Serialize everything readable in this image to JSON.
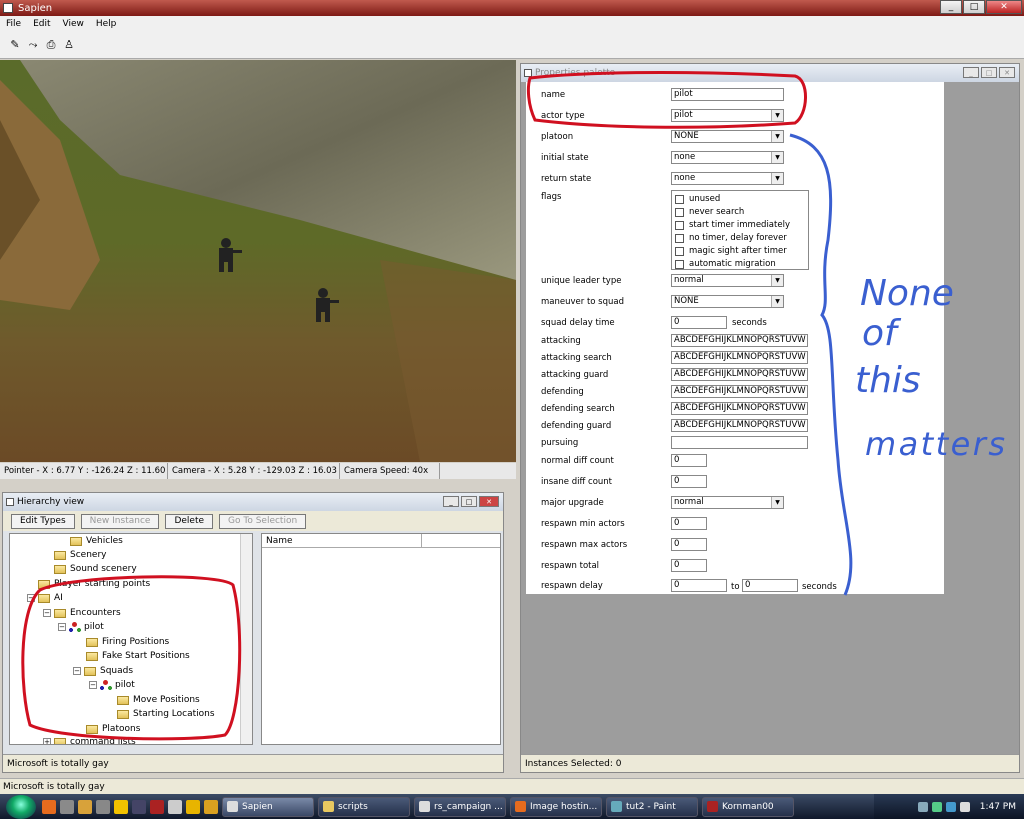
{
  "window": {
    "title": "Sapien",
    "min": "_",
    "max": "□",
    "close": "✕"
  },
  "menu": [
    "File",
    "Edit",
    "View",
    "Help"
  ],
  "toolbar": {
    "tools": [
      "pencil-tool",
      "path-tool",
      "camera-tool",
      "actor-tool"
    ]
  },
  "viewport": {
    "pointer": "Pointer - X : 6.77  Y : -126.24  Z : 11.60",
    "camera": "Camera - X : 5.28  Y : -129.03  Z : 16.03",
    "speed": "Camera Speed: 40x"
  },
  "hierarchy": {
    "title": "Hierarchy view",
    "buttons": {
      "edit_types": "Edit Types",
      "new_instance": "New Instance",
      "delete": "Delete",
      "go_to_selection": "Go To Selection"
    },
    "tree": [
      {
        "label": "Vehicles",
        "kind": "folder"
      },
      {
        "label": "Scenery",
        "kind": "folder"
      },
      {
        "label": "Sound scenery",
        "kind": "folder"
      },
      {
        "label": "Player starting points",
        "kind": "folder"
      },
      {
        "label": "AI",
        "kind": "folder"
      },
      {
        "label": "Encounters",
        "kind": "folder"
      },
      {
        "label": "pilot",
        "kind": "encounter"
      },
      {
        "label": "Firing Positions",
        "kind": "folder"
      },
      {
        "label": "Fake Start Positions",
        "kind": "folder"
      },
      {
        "label": "Squads",
        "kind": "folder"
      },
      {
        "label": "pilot",
        "kind": "encounter"
      },
      {
        "label": "Move Positions",
        "kind": "folder"
      },
      {
        "label": "Starting Locations",
        "kind": "folder"
      },
      {
        "label": "Platoons",
        "kind": "folder"
      },
      {
        "label": "command lists",
        "kind": "folder"
      }
    ],
    "list_header": "Name",
    "status": "Microsoft is totally gay"
  },
  "properties": {
    "title": "Properties palette",
    "name_label": "name",
    "name_value": "pilot",
    "actor_type_label": "actor type",
    "actor_type_value": "pilot",
    "platoon_label": "platoon",
    "platoon_value": "NONE",
    "initial_state_label": "initial state",
    "initial_state_value": "none",
    "return_state_label": "return state",
    "return_state_value": "none",
    "flags_label": "flags",
    "flags": [
      "unused",
      "never search",
      "start timer immediately",
      "no timer, delay forever",
      "magic sight after timer",
      "automatic migration"
    ],
    "unique_leader_label": "unique leader type",
    "unique_leader_value": "normal",
    "maneuver_label": "maneuver to squad",
    "maneuver_value": "NONE",
    "squad_delay_label": "squad delay time",
    "squad_delay_value": "0",
    "seconds": "seconds",
    "attacking_label": "attacking",
    "attacking_search_label": "attacking search",
    "attacking_guard_label": "attacking guard",
    "defending_label": "defending",
    "defending_search_label": "defending search",
    "defending_guard_label": "defending guard",
    "letters": "ABCDEFGHIJKLMNOPQRSTUVW",
    "pursuing_label": "pursuing",
    "normal_diff_label": "normal diff count",
    "normal_diff_value": "0",
    "insane_diff_label": "insane diff count",
    "insane_diff_value": "0",
    "major_upgrade_label": "major upgrade",
    "major_upgrade_value": "normal",
    "respawn_min_label": "respawn min actors",
    "respawn_min_value": "0",
    "respawn_max_label": "respawn max actors",
    "respawn_max_value": "0",
    "respawn_total_label": "respawn total",
    "respawn_total_value": "0",
    "respawn_delay_label": "respawn delay",
    "respawn_delay_from": "0",
    "respawn_delay_to_label": "to",
    "respawn_delay_to": "0",
    "status": "Instances Selected: 0"
  },
  "annotation": {
    "line1": "None",
    "line2": "of",
    "line3": "this",
    "line4": "matters",
    "color": "#3a5fd0",
    "circle_color": "#d01020"
  },
  "bottom_status": "Microsoft is totally gay",
  "taskbar": {
    "tasks": [
      "Sapien",
      "scripts",
      "rs_campaign ...",
      "Image hostin...",
      "tut2 - Paint",
      "Kornman00"
    ],
    "clock": "1:47 PM"
  }
}
